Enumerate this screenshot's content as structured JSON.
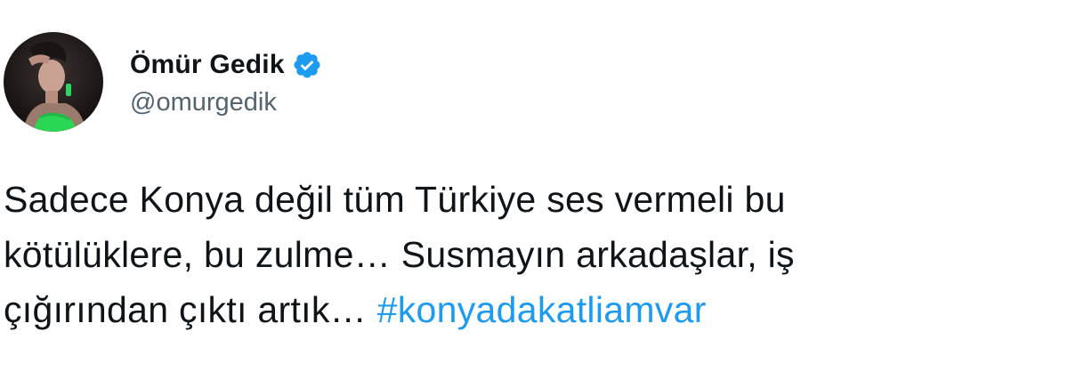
{
  "tweet": {
    "author": {
      "display_name": "Ömür Gedik",
      "handle": "@omurgedik",
      "verified": true
    },
    "text": {
      "line1": "Sadece Konya değil tüm Türkiye ses vermeli bu",
      "line2": "kötülüklere, bu zulme… Susmayın arkadaşlar, iş",
      "line3_prefix": "çığırından çıktı artık… ",
      "hashtag": "#konyadakatliamvar"
    }
  },
  "icons": {
    "verified": "verified-badge-icon",
    "avatar": "profile-photo"
  },
  "colors": {
    "text": "#0f1419",
    "secondary": "#536471",
    "accent": "#1d9bf0"
  }
}
